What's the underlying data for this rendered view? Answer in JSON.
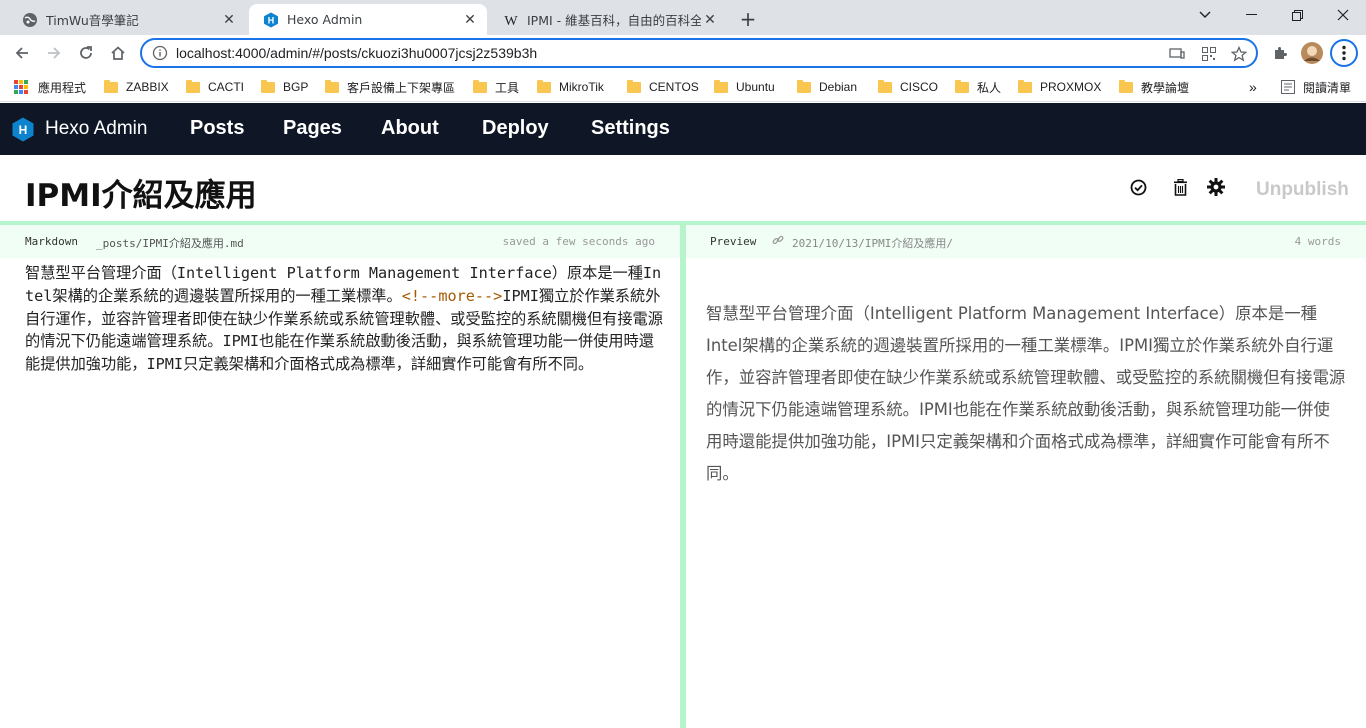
{
  "browser": {
    "tabs": [
      {
        "title": "TimWu音學筆記",
        "favicon": "globe-icon",
        "active": false
      },
      {
        "title": "Hexo Admin",
        "favicon": "hexo-icon",
        "active": true
      },
      {
        "title": "IPMI - 維基百科，自由的百科全書",
        "favicon": "wikipedia-icon",
        "active": false
      }
    ],
    "new_tab_label": "+",
    "url": "localhost:4000/admin/#/posts/ckuozi3hu0007jcsj2z539b3h",
    "bookmarks": [
      {
        "label": "應用程式",
        "icon": "apps-icon"
      },
      {
        "label": "ZABBIX",
        "icon": "folder-icon"
      },
      {
        "label": "CACTI",
        "icon": "folder-icon"
      },
      {
        "label": "BGP",
        "icon": "folder-icon"
      },
      {
        "label": "客戶設備上下架專區",
        "icon": "folder-icon"
      },
      {
        "label": "工具",
        "icon": "folder-icon"
      },
      {
        "label": "MikroTik",
        "icon": "folder-icon"
      },
      {
        "label": "CENTOS",
        "icon": "folder-icon"
      },
      {
        "label": "Ubuntu",
        "icon": "folder-icon"
      },
      {
        "label": "Debian",
        "icon": "folder-icon"
      },
      {
        "label": "CISCO",
        "icon": "folder-icon"
      },
      {
        "label": "私人",
        "icon": "folder-icon"
      },
      {
        "label": "PROXMOX",
        "icon": "folder-icon"
      },
      {
        "label": "教學論壇",
        "icon": "folder-icon"
      }
    ],
    "overflow_label": "»",
    "reading_list_label": "閱讀清單"
  },
  "app": {
    "brand": "Hexo Admin",
    "nav": [
      "Posts",
      "Pages",
      "About",
      "Deploy",
      "Settings"
    ],
    "accent_color": "#0f1726",
    "highlight_color": "#b6f5cc"
  },
  "post": {
    "title": "IPMI介紹及應用",
    "unpublish_label": "Unpublish",
    "editor_meta": {
      "mode": "Markdown",
      "path": "_posts/IPMI介紹及應用.md",
      "status": "saved a few seconds ago"
    },
    "preview_meta": {
      "mode": "Preview",
      "permalink": "2021/10/13/IPMI介紹及應用/",
      "word_count": "4 words"
    },
    "markdown": {
      "before_more": "智慧型平台管理介面（Intelligent Platform Management Interface）原本是一種Intel架構的企業系統的週邊裝置所採用的一種工業標準。",
      "more_tag": "<!--more-->",
      "after_more": "IPMI獨立於作業系統外自行運作，並容許管理者即使在缺少作業系統或系統管理軟體、或受監控的系統關機但有接電源的情況下仍能遠端管理系統。IPMI也能在作業系統啟動後活動，與系統管理功能一併使用時還能提供加強功能，IPMI只定義架構和介面格式成為標準，詳細實作可能會有所不同。"
    },
    "preview_text": "智慧型平台管理介面（Intelligent Platform Management Interface）原本是一種Intel架構的企業系統的週邊裝置所採用的一種工業標準。IPMI獨立於作業系統外自行運作，並容許管理者即使在缺少作業系統或系統管理軟體、或受監控的系統關機但有接電源的情況下仍能遠端管理系統。IPMI也能在作業系統啟動後活動，與系統管理功能一併使用時還能提供加強功能，IPMI只定義架構和介面格式成為標準，詳細實作可能會有所不同。"
  }
}
